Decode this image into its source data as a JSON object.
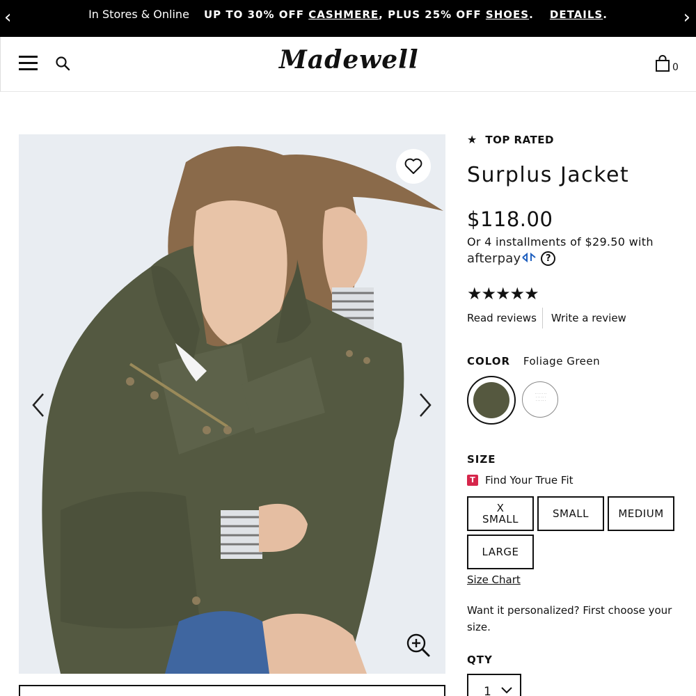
{
  "promo": {
    "lead": "In Stores & Online",
    "deal_prefix": "UP TO 30% OFF ",
    "deal_link1": "CASHMERE",
    "deal_mid": ", PLUS 25% OFF ",
    "deal_link2": "SHOES",
    "deal_suffix": ".",
    "details": "DETAILS",
    "details_suffix": ".",
    "prev": "‹",
    "next": "›"
  },
  "header": {
    "logo": "Madewell",
    "bag_count": "0"
  },
  "gallery": {
    "prev_icon": "chevron-left-icon",
    "next_icon": "chevron-right-icon"
  },
  "product": {
    "badge_icon": "★",
    "badge": "TOP RATED",
    "name": "Surplus Jacket",
    "price": "$118.00",
    "installments": "Or 4 installments of $29.50 with",
    "afterpay_brand_a": "afterpay",
    "afterpay_brand_b": "",
    "afterpay_help": "?",
    "rating_stars": "★★★★★",
    "rating": 5,
    "read_reviews": "Read reviews",
    "write_review": "Write a review",
    "color_label": "COLOR",
    "color_value": "Foliage Green",
    "swatch_colors": [
      "#55583f",
      "#ffffff"
    ],
    "size_label": "SIZE",
    "fit_badge": "T",
    "fit_link": "Find Your True Fit",
    "sizes": [
      "X SMALL",
      "SMALL",
      "MEDIUM",
      "LARGE"
    ],
    "size_chart": "Size Chart",
    "personalized": "Want it personalized? First choose your size.",
    "qty_label": "QTY",
    "qty_value": "1"
  }
}
